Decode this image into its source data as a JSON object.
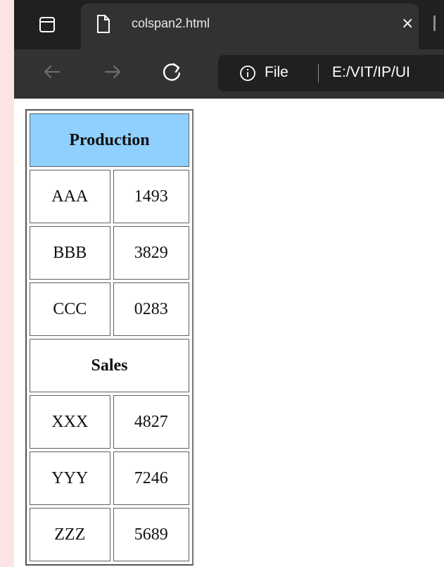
{
  "browser": {
    "tab": {
      "title": "colspan2.html",
      "close_glyph": "×",
      "icon": "document-icon"
    },
    "toolbar": {
      "back_icon": "back-arrow-icon",
      "forward_icon": "forward-arrow-icon",
      "refresh_icon": "refresh-icon"
    },
    "address": {
      "site_label": "File",
      "url": "E:/VIT/IP/UI"
    }
  },
  "table": {
    "sections": [
      {
        "heading": "Production",
        "rows": [
          {
            "label": "AAA",
            "value": "1493"
          },
          {
            "label": "BBB",
            "value": "3829"
          },
          {
            "label": "CCC",
            "value": "0283"
          }
        ]
      },
      {
        "heading": "Sales",
        "rows": [
          {
            "label": "XXX",
            "value": "4827"
          },
          {
            "label": "YYY",
            "value": "7246"
          },
          {
            "label": "ZZZ",
            "value": "5689"
          }
        ]
      }
    ]
  },
  "colors": {
    "production_header": "#8fd0ff",
    "chrome_dark": "#202020",
    "chrome_mid": "#323232",
    "page_left_strip": "#fde4e4"
  }
}
